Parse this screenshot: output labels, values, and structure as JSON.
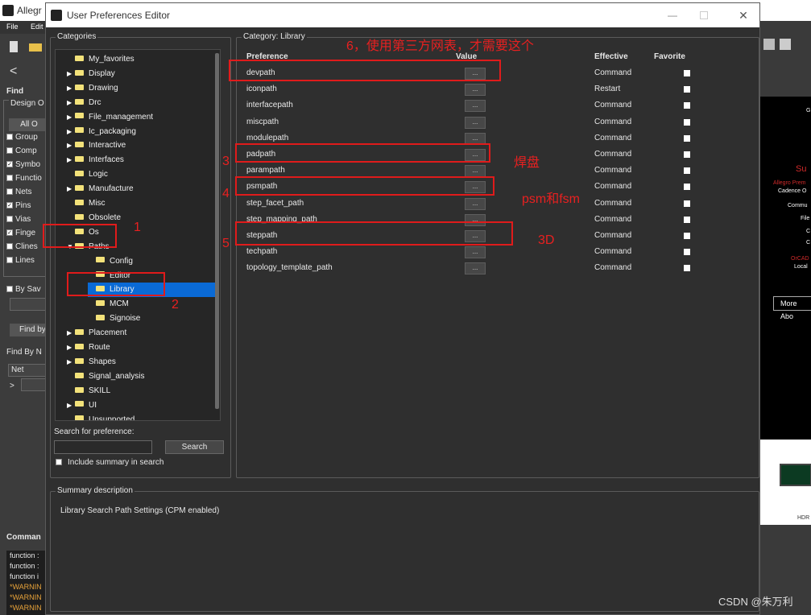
{
  "bg_app": {
    "title": "Allegr",
    "menu": [
      "File",
      "Edit"
    ],
    "find_label": "Find",
    "design_label": "Design O",
    "all_button": "All O",
    "find_items": [
      {
        "label": "Group",
        "checked": false
      },
      {
        "label": "Comp",
        "checked": false
      },
      {
        "label": "Symbo",
        "checked": true
      },
      {
        "label": "Functio",
        "checked": false
      },
      {
        "label": "Nets",
        "checked": false
      },
      {
        "label": "Pins",
        "checked": true
      },
      {
        "label": "Vias",
        "checked": false
      },
      {
        "label": "Finge",
        "checked": true
      },
      {
        "label": "Clines",
        "checked": false
      },
      {
        "label": "Lines",
        "checked": false
      }
    ],
    "by_sav": "By Sav",
    "find_by_button": "Find by",
    "find_by_n": "Find By N",
    "net_select": "Net",
    "net_arrow": ">",
    "command_label": "Comman",
    "command_lines": [
      "function :",
      "function :",
      "function i",
      "*WARNIN",
      "*WARNIN",
      "*WARNIN"
    ],
    "right_texts": [
      "G",
      "Su",
      "Allegro Prem",
      "Cadence O",
      "Commu",
      "File",
      "C",
      "C",
      "OrCAD",
      "Local"
    ],
    "more_about": "More Abo",
    "hdr_text": "HDR",
    "watermark": "CSDN @朱万利"
  },
  "dialog": {
    "title": "User Preferences Editor",
    "categories_label": "Categories",
    "tree": [
      {
        "label": "My_favorites",
        "depth": 0,
        "expander": ""
      },
      {
        "label": "Display",
        "depth": 0,
        "expander": "▶"
      },
      {
        "label": "Drawing",
        "depth": 0,
        "expander": "▶"
      },
      {
        "label": "Drc",
        "depth": 0,
        "expander": "▶"
      },
      {
        "label": "File_management",
        "depth": 0,
        "expander": "▶"
      },
      {
        "label": "Ic_packaging",
        "depth": 0,
        "expander": "▶"
      },
      {
        "label": "Interactive",
        "depth": 0,
        "expander": "▶"
      },
      {
        "label": "Interfaces",
        "depth": 0,
        "expander": "▶"
      },
      {
        "label": "Logic",
        "depth": 0,
        "expander": ""
      },
      {
        "label": "Manufacture",
        "depth": 0,
        "expander": "▶"
      },
      {
        "label": "Misc",
        "depth": 0,
        "expander": ""
      },
      {
        "label": "Obsolete",
        "depth": 0,
        "expander": ""
      },
      {
        "label": "Os",
        "depth": 0,
        "expander": ""
      },
      {
        "label": "Paths",
        "depth": 0,
        "expander": "▼"
      },
      {
        "label": "Config",
        "depth": 1,
        "expander": ""
      },
      {
        "label": "Editor",
        "depth": 1,
        "expander": ""
      },
      {
        "label": "Library",
        "depth": 1,
        "expander": "",
        "selected": true
      },
      {
        "label": "MCM",
        "depth": 1,
        "expander": ""
      },
      {
        "label": "Signoise",
        "depth": 1,
        "expander": ""
      },
      {
        "label": "Placement",
        "depth": 0,
        "expander": "▶"
      },
      {
        "label": "Route",
        "depth": 0,
        "expander": "▶"
      },
      {
        "label": "Shapes",
        "depth": 0,
        "expander": "▶"
      },
      {
        "label": "Signal_analysis",
        "depth": 0,
        "expander": ""
      },
      {
        "label": "SKILL",
        "depth": 0,
        "expander": ""
      },
      {
        "label": "UI",
        "depth": 0,
        "expander": "▶"
      },
      {
        "label": "Unsupported",
        "depth": 0,
        "expander": ""
      }
    ],
    "search_label": "Search for preference:",
    "search_value": "",
    "search_button": "Search",
    "include_summary": "Include summary in search",
    "category_title": "Category:  Library",
    "columns": {
      "preference": "Preference",
      "value": "Value",
      "effective": "Effective",
      "favorite": "Favorite"
    },
    "value_button": "...",
    "preferences": [
      {
        "name": "devpath",
        "effective": "Command"
      },
      {
        "name": "iconpath",
        "effective": "Restart"
      },
      {
        "name": "interfacepath",
        "effective": "Command"
      },
      {
        "name": "miscpath",
        "effective": "Command"
      },
      {
        "name": "modulepath",
        "effective": "Command"
      },
      {
        "name": "padpath",
        "effective": "Command"
      },
      {
        "name": "parampath",
        "effective": "Command"
      },
      {
        "name": "psmpath",
        "effective": "Command"
      },
      {
        "name": "step_facet_path",
        "effective": "Command"
      },
      {
        "name": "step_mapping_path",
        "effective": "Command"
      },
      {
        "name": "steppath",
        "effective": "Command"
      },
      {
        "name": "techpath",
        "effective": "Command"
      },
      {
        "name": "topology_template_path",
        "effective": "Command"
      }
    ],
    "summary_label": "Summary description",
    "summary_text": "Library Search Path Settings (CPM enabled)"
  },
  "annotations": {
    "n1": "1",
    "n2": "2",
    "n3": "3",
    "n4": "4",
    "n5": "5",
    "n6": "6，使用第三方网表，才需要这个",
    "pad": "焊盘",
    "psm": "psm和fsm",
    "step": "3D",
    "color": "#e01b1b"
  }
}
